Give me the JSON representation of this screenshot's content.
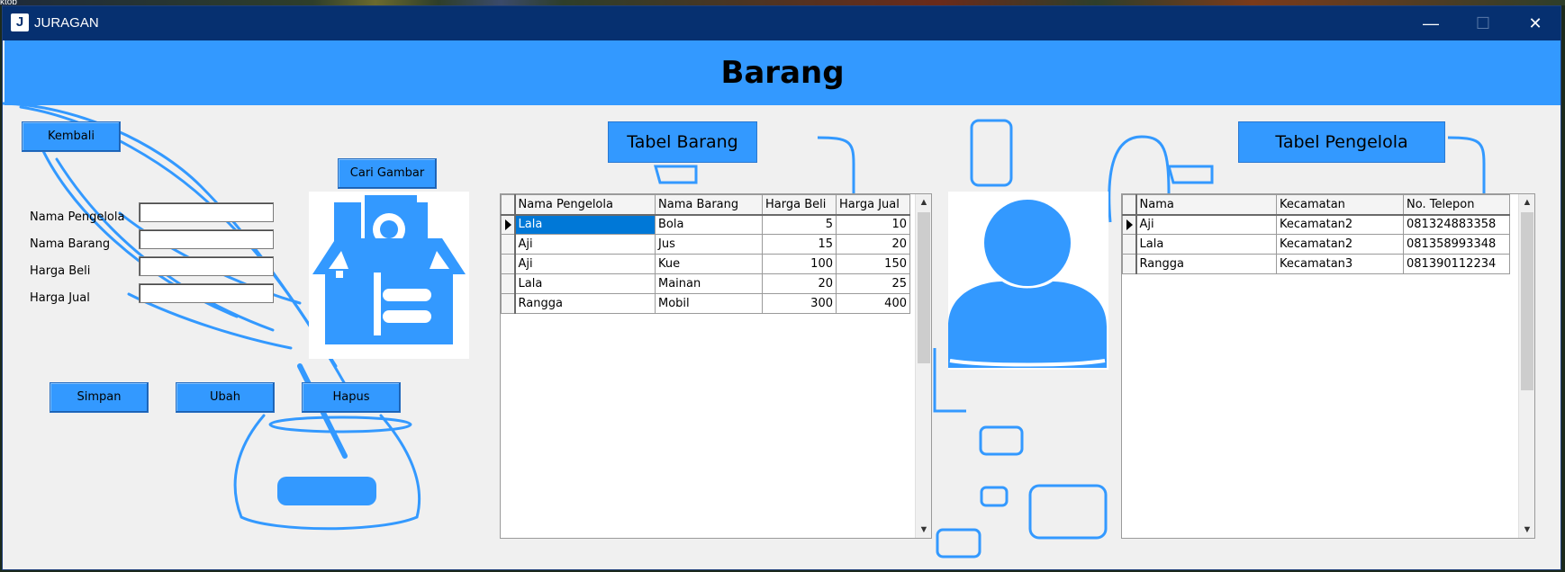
{
  "desktop": {
    "corner_label": "ktob"
  },
  "window": {
    "app_icon": "J",
    "title": "JURAGAN",
    "minimize_glyph": "—",
    "maximize_glyph": "☐",
    "close_glyph": "✕"
  },
  "header": {
    "title": "Barang"
  },
  "actions": {
    "back_label": "Kembali",
    "browse_image_label": "Cari Gambar",
    "save_label": "Simpan",
    "edit_label": "Ubah",
    "delete_label": "Hapus"
  },
  "form": {
    "fields": [
      {
        "label": "Nama Pengelola",
        "value": ""
      },
      {
        "label": "Nama Barang",
        "value": ""
      },
      {
        "label": "Harga Beli",
        "value": ""
      },
      {
        "label": "Harga Jual",
        "value": ""
      }
    ]
  },
  "barang_table": {
    "caption": "Tabel Barang",
    "columns": [
      "Nama Pengelola",
      "Nama Barang",
      "Harga Beli",
      "Harga Jual"
    ],
    "rows": [
      [
        "Lala",
        "Bola",
        "5",
        "10"
      ],
      [
        "Aji",
        "Jus",
        "15",
        "20"
      ],
      [
        "Aji",
        "Kue",
        "100",
        "150"
      ],
      [
        "Lala",
        "Mainan",
        "20",
        "25"
      ],
      [
        "Rangga",
        "Mobil",
        "300",
        "400"
      ]
    ],
    "selected_row": 0
  },
  "pengelola_table": {
    "caption": "Tabel Pengelola",
    "columns": [
      "Nama",
      "Kecamatan",
      "No. Telepon"
    ],
    "rows": [
      [
        "Aji",
        "Kecamatan2",
        "081324883358"
      ],
      [
        "Lala",
        "Kecamatan2",
        "081358993348"
      ],
      [
        "Rangga",
        "Kecamatan3",
        "081390112234"
      ]
    ],
    "selected_row": 0
  },
  "icons": {
    "product_image": "box-icon",
    "person_image": "user-icon",
    "scroll_up": "▲",
    "scroll_down": "▼"
  },
  "colors": {
    "accent": "#3399ff",
    "titlebar": "#063070",
    "selection": "#0078d7",
    "background": "#f0f0f0"
  }
}
